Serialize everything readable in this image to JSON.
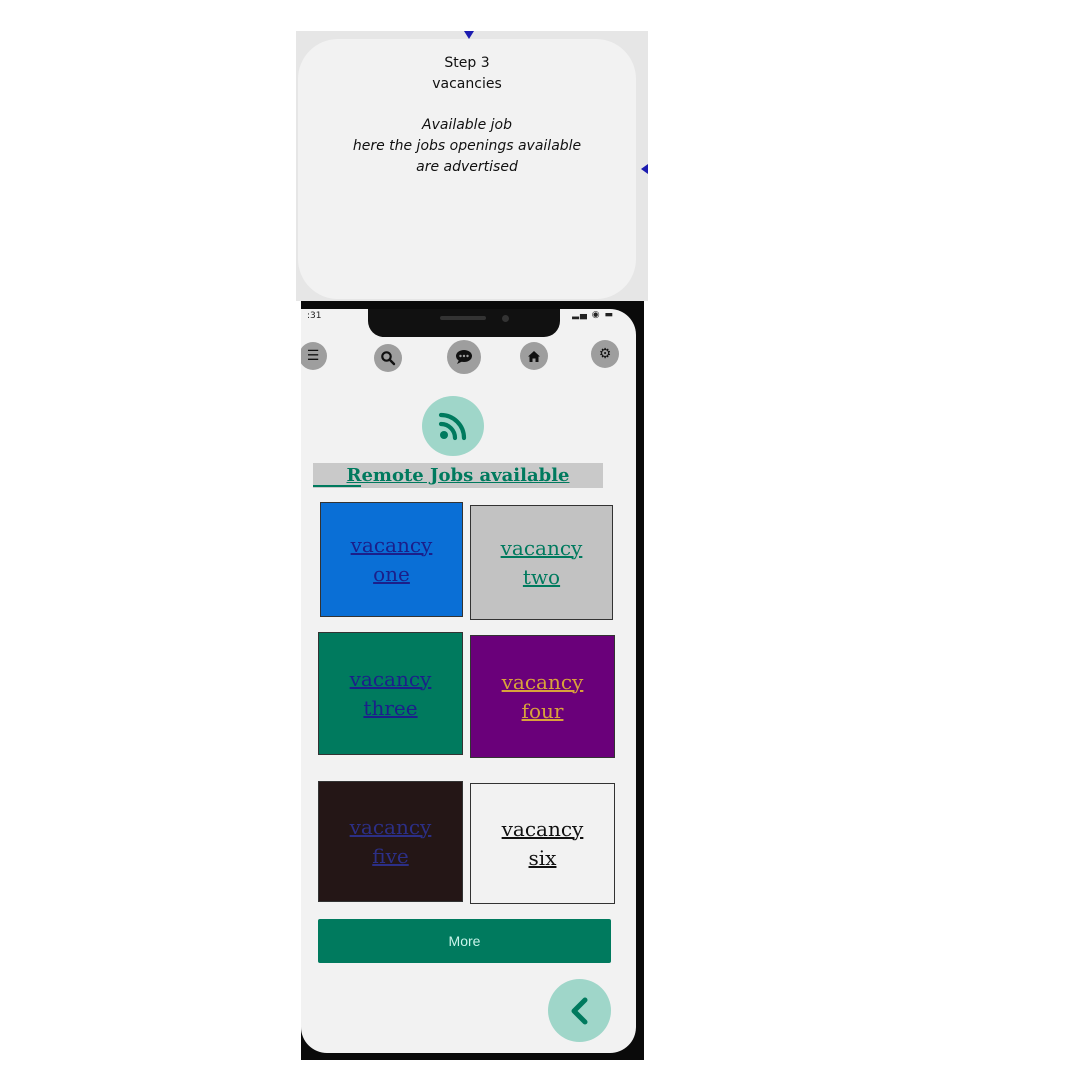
{
  "note": {
    "step": "Step 3",
    "title": "vacancies",
    "desc_line1": "Available job",
    "desc_line2": "here the jobs openings available",
    "desc_line3": "are advertised"
  },
  "status": {
    "time": ":31",
    "icons": "▂▄ ◉ ▬"
  },
  "nav": [
    {
      "icon": "menu-icon",
      "glyph": "☰"
    },
    {
      "icon": "search-icon",
      "glyph": "⌕"
    },
    {
      "icon": "chat-icon",
      "glyph": "💬"
    },
    {
      "icon": "home-icon",
      "glyph": "⌂"
    },
    {
      "icon": "gear-icon",
      "glyph": "⚙"
    }
  ],
  "section": {
    "title": "Remote Jobs available",
    "icon": "rss-feed-icon"
  },
  "vacancies": [
    {
      "line1": "vacancy",
      "line2": "one",
      "bg": "#0a6fd6",
      "fg": "#1b1f8a"
    },
    {
      "line1": "vacancy",
      "line2": "two",
      "bg": "#c2c2c2",
      "fg": "#007a5e"
    },
    {
      "line1": "vacancy",
      "line2": "three",
      "bg": "#007a5e",
      "fg": "#1b1f8a"
    },
    {
      "line1": "vacancy",
      "line2": "four",
      "bg": "#6a007a",
      "fg": "#d9a33a"
    },
    {
      "line1": "vacancy",
      "line2": "five",
      "bg": "#241616",
      "fg": "#2c2f86"
    },
    {
      "line1": "vacancy",
      "line2": "six",
      "bg": "#f2f2f2",
      "fg": "#111111"
    }
  ],
  "more_label": "More",
  "back_icon": "chevron-left-icon",
  "colors": {
    "accent": "#007a5e",
    "accent_light": "#9fd6c9",
    "annotation": "#1c1cb0"
  }
}
